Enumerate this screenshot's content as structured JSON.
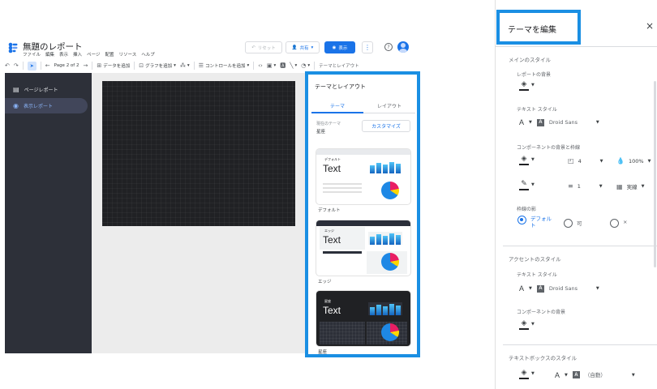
{
  "app": {
    "title": "無題のレポート",
    "menu": [
      "ファイル",
      "編集",
      "表示",
      "挿入",
      "ページ",
      "配置",
      "リソース",
      "ヘルプ"
    ],
    "reset_label": "リセット",
    "share_label": "共有",
    "view_label": "表示",
    "help_glyph": "?"
  },
  "toolbar": {
    "page_indicator": "Page 2 of 2",
    "add_data": "データを追加",
    "add_chart": "グラフを追加",
    "add_control": "コントロールを追加",
    "theme_layout": "テーマとレイアウト"
  },
  "sidebar": {
    "items": [
      {
        "label": "ページレポート",
        "icon": "page-icon"
      },
      {
        "label": "表示レポート",
        "icon": "eye-icon"
      }
    ]
  },
  "theme_panel": {
    "title": "テーマとレイアウト",
    "tabs": [
      "テーマ",
      "レイアウト"
    ],
    "current_theme_label": "現在のテーマ",
    "current_theme_value": "星座",
    "customize_label": "カスタマイズ",
    "themes": [
      {
        "name": "デフォルト",
        "tag": "デフォルト",
        "sample_text": "Text"
      },
      {
        "name": "エッジ",
        "tag": "エッジ",
        "sample_text": "Text"
      },
      {
        "name": "星座",
        "tag": "星座",
        "sample_text": "Text"
      }
    ]
  },
  "edit_theme": {
    "title": "テーマを編集",
    "close_glyph": "×",
    "main_style": "メインのスタイル",
    "report_bg": "レポートの背景",
    "text_style": "テキスト スタイル",
    "font_name": "Droid Sans",
    "component_bg_border": "コンポーネントの背景と枠線",
    "border_radius": "4",
    "opacity": "100%",
    "border_weight": "1",
    "border_style": "実線",
    "border_shadow": "枠線の影",
    "shadow_options": [
      "デフォルト",
      "可",
      "×"
    ],
    "accent_style": "アクセントのスタイル",
    "accent_text_style": "テキスト スタイル",
    "accent_font_name": "Droid Sans",
    "accent_component_bg": "コンポーネントの背景",
    "textbox_style": "テキストボックスのスタイル",
    "textbox_font": "（自動）"
  },
  "colors": {
    "accent": "#1a73e8",
    "highlight_border": "#1a8fe3",
    "sidebar_bg": "#2d3039",
    "canvas_page": "#202124"
  }
}
